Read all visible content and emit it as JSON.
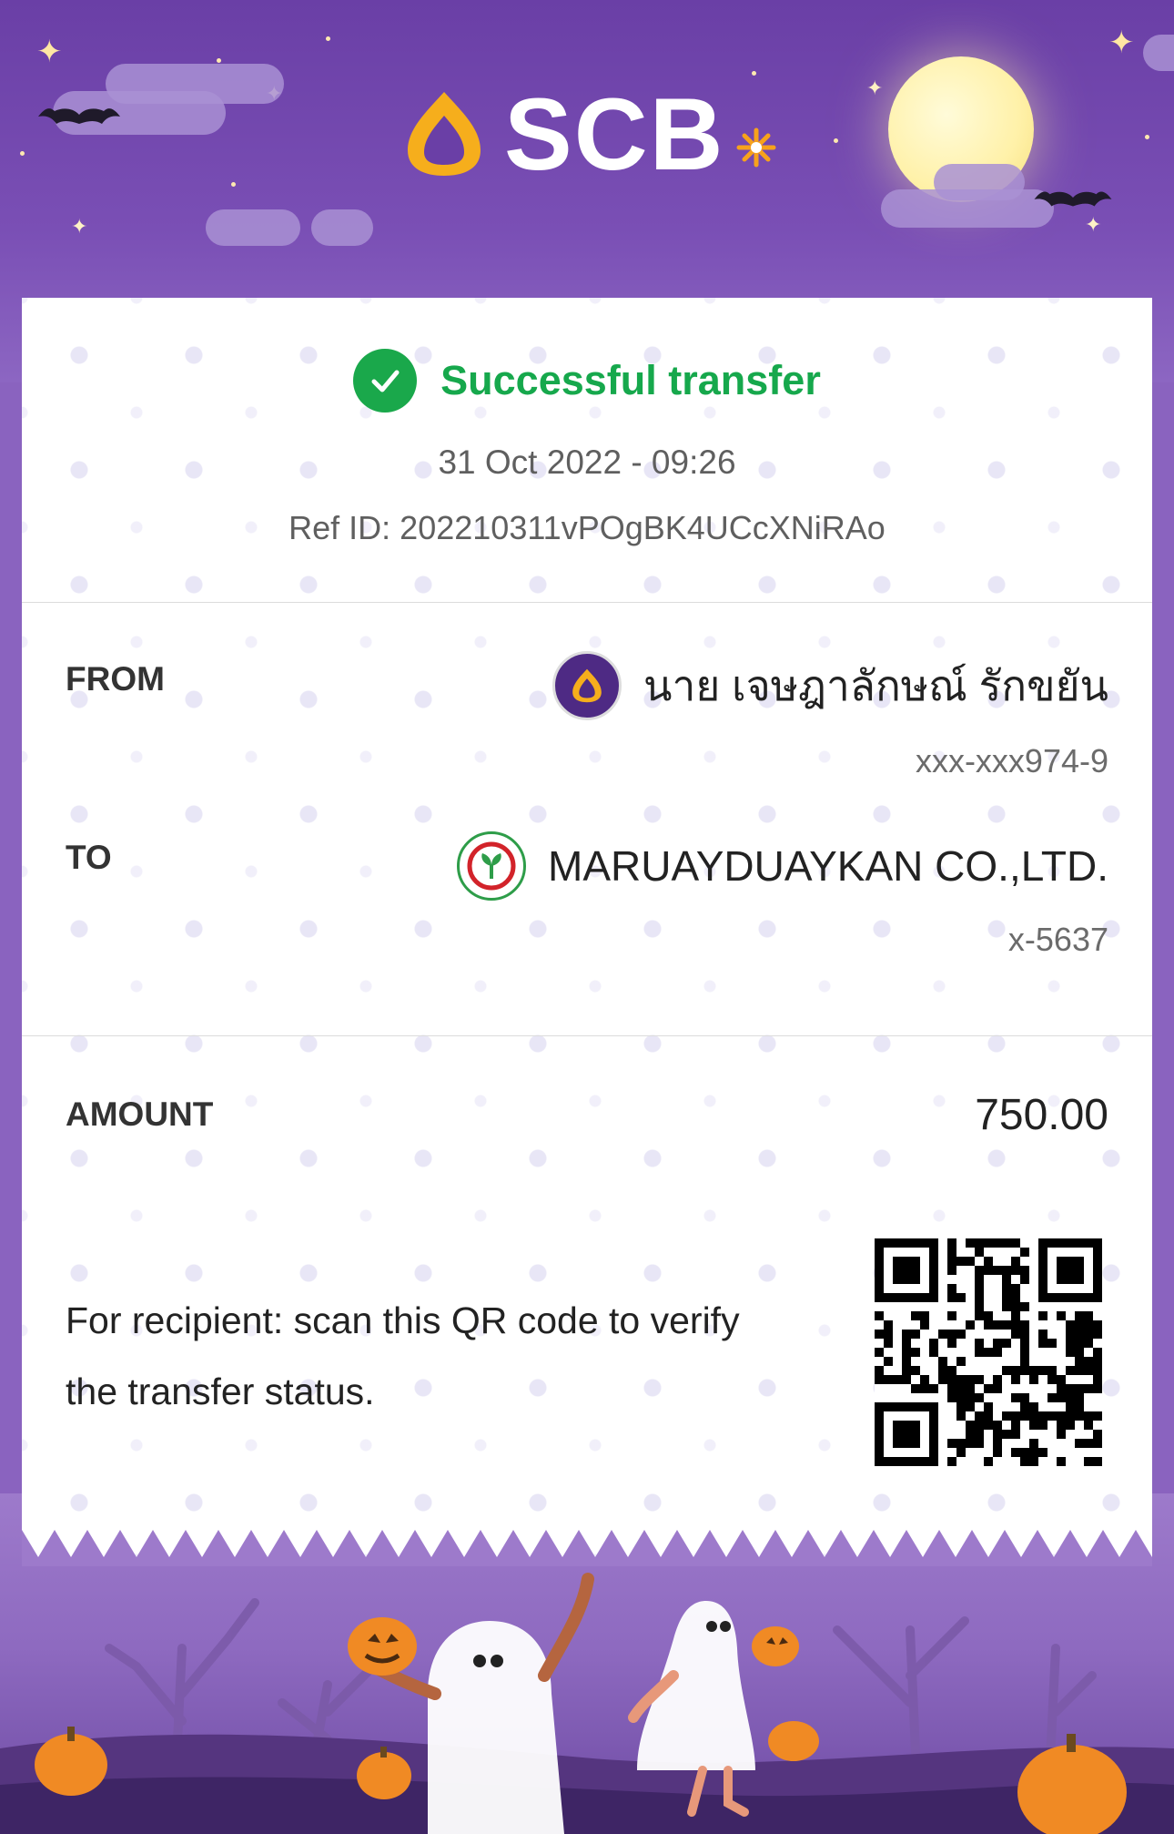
{
  "header": {
    "brand": "SCB",
    "colors": {
      "primary": "#4e2a84",
      "background_purple": "#7a4fb5",
      "logo_gold": "#f5a623"
    }
  },
  "status": {
    "icon": "check-circle-icon",
    "text": "Successful transfer",
    "color": "#16a84c",
    "datetime": "31 Oct 2022 - 09:26",
    "ref_id": "Ref ID: 202210311vPOgBK4UCcXNiRAo"
  },
  "from": {
    "label": "FROM",
    "bank_icon": "scb-bank-icon",
    "name": "นาย เจษฎาลักษณ์ รักขยัน",
    "account": "xxx-xxx974-9"
  },
  "to": {
    "label": "TO",
    "bank_icon": "kbank-bank-icon",
    "name": "MARUAYDUAYKAN CO.,LTD.",
    "account": "x-5637"
  },
  "amount": {
    "label": "AMOUNT",
    "value": "750.00"
  },
  "verify": {
    "text": "For recipient: scan this QR code to verify the transfer status.",
    "qr_icon": "qr-code-icon"
  }
}
